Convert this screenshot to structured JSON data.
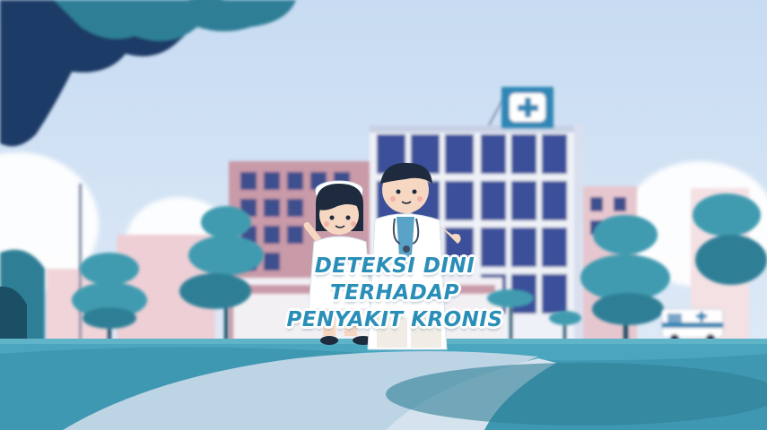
{
  "title": {
    "line1": "DETEKSI DINI",
    "line2": "TERHADAP",
    "line3": "PENYAKIT KRONIS"
  },
  "colors": {
    "sky": "#cfe0f3",
    "title_text": "#2a8fb8",
    "title_outline": "#ffffff",
    "hospital_window": "#3a4f9a",
    "tree": "#3f9bb0",
    "ground": "#4aa6bf"
  },
  "icons": {
    "hospital_sign": "medical-cross-icon",
    "ambulance_sign": "medical-cross-icon"
  }
}
